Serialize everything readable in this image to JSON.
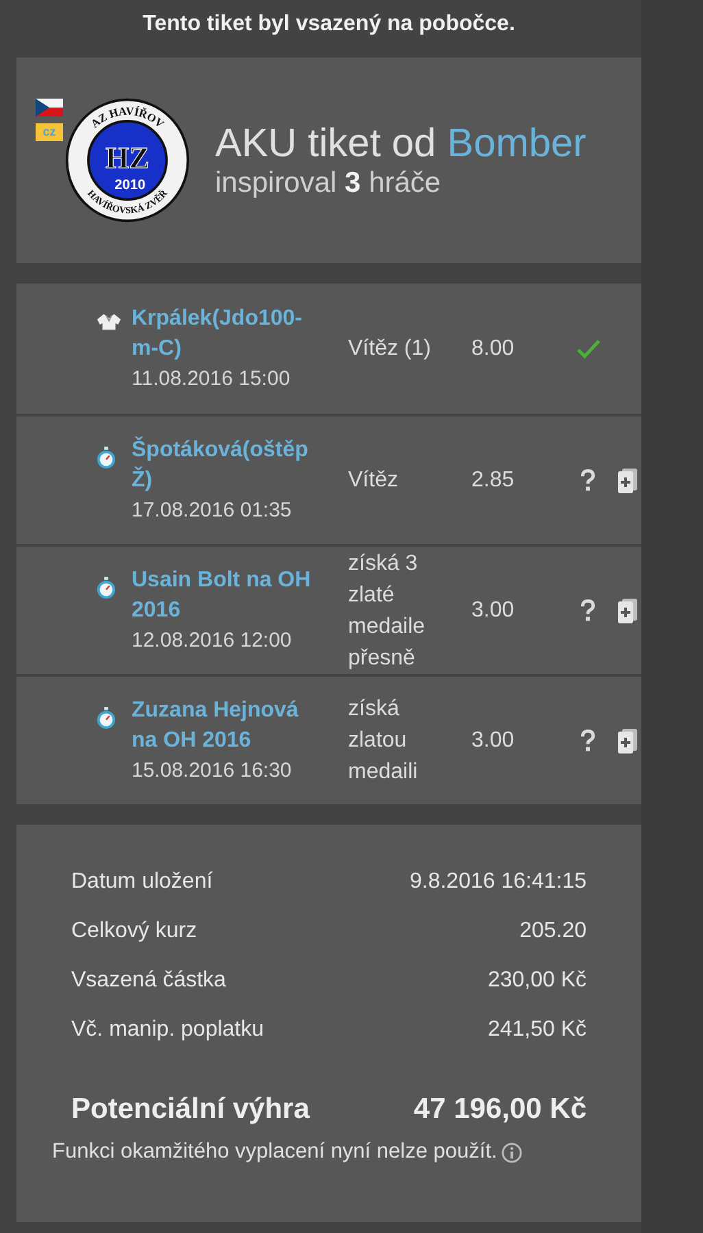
{
  "notice": "Tento tiket byl vsazený na pobočce.",
  "header": {
    "logo": {
      "ring_top": "AZ HAVÍŘOV",
      "ring_bottom": "HAVÍŘOVSKÁ ZVĚŘ",
      "initials": "HZ",
      "year": "2010"
    },
    "badge": "cz",
    "title": "AKU tiket od",
    "author": "Bomber",
    "subtitle": "inspiroval **3** hráče"
  },
  "legs": [
    {
      "kind": "judo",
      "name": "Krpálek(Jdo100-m-C)",
      "date": "11.08.2016 15:00",
      "bet": "Vítěz (1)",
      "odds": "8.00",
      "won": true,
      "addable": false
    },
    {
      "kind": "stopwatch",
      "name": "Špotáková(oštěp Ž)",
      "date": "17.08.2016 01:35",
      "bet": "Vítěz",
      "odds": "2.85",
      "won": false,
      "addable": true
    },
    {
      "kind": "stopwatch",
      "name": "Usain Bolt na OH 2016",
      "date": "12.08.2016 12:00",
      "bet": "získá 3 zlaté medaile přesně",
      "odds": "3.00",
      "won": false,
      "addable": true
    },
    {
      "kind": "stopwatch",
      "name": "Zuzana Hejnová na OH 2016",
      "date": "15.08.2016 16:30",
      "bet": "získá zlatou medaili",
      "odds": "3.00",
      "won": false,
      "addable": true
    }
  ],
  "summary": [
    {
      "label": "Datum uložení",
      "value": "9.8.2016 16:41:15"
    },
    {
      "label": "Celkový kurz",
      "value": "205.20"
    },
    {
      "label": "Vsazená částka",
      "value": "230,00 Kč"
    },
    {
      "label": "Vč. manip. poplatku",
      "value": "241,50 Kč"
    }
  ],
  "total": {
    "label": "Potenciální výhra",
    "value": "47 196,00 Kč"
  },
  "footnote": "Funkci okamžitého vyplacení nyní nelze použít."
}
